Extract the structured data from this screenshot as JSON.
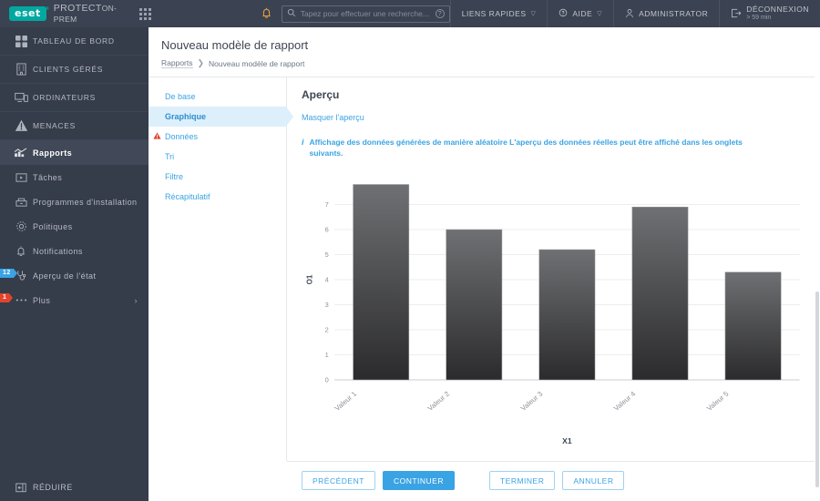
{
  "topbar": {
    "logo_text": "eset",
    "logo_tm": "®",
    "product_main": "PROTECT",
    "product_suffix": "ON-PREM",
    "apps_icon": "apps-grid-icon",
    "bell_icon": "notification-bell-icon",
    "search": {
      "placeholder": "Tapez pour effectuer une recherche...",
      "value": "",
      "icon": "search-icon",
      "help_icon": "question-mark-icon"
    },
    "quick_links": "LIENS RAPIDES",
    "help": "AIDE",
    "user": "ADMINISTRATOR",
    "logout": "DÉCONNEXION",
    "logout_timer": "> 59 min"
  },
  "sidebar": {
    "items": [
      {
        "label": "TABLEAU DE BORD",
        "icon": "dashboard-grid-icon",
        "section": true,
        "active": false,
        "badge": null
      },
      {
        "label": "CLIENTS GÉRÉS",
        "icon": "building-icon",
        "section": true,
        "active": false,
        "badge": null
      },
      {
        "label": "ORDINATEURS",
        "icon": "computer-icon",
        "section": true,
        "active": false,
        "badge": null
      },
      {
        "label": "MENACES",
        "icon": "warning-triangle-icon",
        "section": true,
        "active": false,
        "badge": null
      },
      {
        "label": "Rapports",
        "icon": "chart-bars-icon",
        "section": false,
        "active": true,
        "badge": null
      },
      {
        "label": "Tâches",
        "icon": "play-box-icon",
        "section": false,
        "active": false,
        "badge": null
      },
      {
        "label": "Programmes d'installation",
        "icon": "installer-box-icon",
        "section": false,
        "active": false,
        "badge": null
      },
      {
        "label": "Politiques",
        "icon": "gear-icon",
        "section": false,
        "active": false,
        "badge": null
      },
      {
        "label": "Notifications",
        "icon": "bell-outline-icon",
        "section": false,
        "active": false,
        "badge": null
      },
      {
        "label": "Aperçu de l'état",
        "icon": "stethoscope-icon",
        "section": false,
        "active": false,
        "badge": "12",
        "badge_color": "#3aa3e3"
      },
      {
        "label": "Plus",
        "icon": "ellipsis-icon",
        "section": false,
        "active": false,
        "badge": "1",
        "badge_color": "#e0452c",
        "chevron": "chevron-right-icon"
      }
    ],
    "collapse": {
      "label": "RÉDUIRE",
      "icon": "collapse-panel-icon"
    }
  },
  "page": {
    "title": "Nouveau modèle de rapport",
    "breadcrumb_root": "Rapports",
    "breadcrumb_sep": "❯",
    "breadcrumb_current": "Nouveau modèle de rapport"
  },
  "steps": [
    {
      "label": "De base",
      "selected": false,
      "warning": false
    },
    {
      "label": "Graphique",
      "selected": true,
      "warning": false
    },
    {
      "label": "Données",
      "selected": false,
      "warning": true,
      "warn_icon": "warning-triangle-icon"
    },
    {
      "label": "Tri",
      "selected": false,
      "warning": false
    },
    {
      "label": "Filtre",
      "selected": false,
      "warning": false
    },
    {
      "label": "Récapitulatif",
      "selected": false,
      "warning": false
    }
  ],
  "preview": {
    "heading": "Aperçu",
    "hide_link": "Masquer l'aperçu",
    "info_icon": "info-icon",
    "info_text": "Affichage des données générées de manière aléatoire L'aperçu des données réelles peut être affiché dans les onglets suivants."
  },
  "footer": {
    "previous": "PRÉCÉDENT",
    "continue": "CONTINUER",
    "finish": "TERMINER",
    "cancel": "ANNULER"
  },
  "colors": {
    "accent_blue": "#3aa3e3",
    "brand_teal": "#00a8a0",
    "sidebar_bg": "#353c4a",
    "topbar_bg": "#3b4251",
    "warning_red": "#e0452c",
    "bell_amber": "#e8a33d"
  },
  "chart_data": {
    "type": "bar",
    "title": "",
    "categories": [
      "Valeur 1",
      "Valeur 2",
      "Valeur 3",
      "Valeur 4",
      "Valeur 5"
    ],
    "values": [
      7.8,
      6.0,
      5.2,
      6.9,
      4.3
    ],
    "xlabel": "X1",
    "ylabel": "O1",
    "yticks": [
      0,
      1,
      2,
      3,
      4,
      5,
      6,
      7
    ],
    "ylim": [
      0,
      8
    ],
    "grid": true,
    "legend": false,
    "bar_gradient_top": "#6f7073",
    "bar_gradient_bottom": "#2b2b2d"
  }
}
